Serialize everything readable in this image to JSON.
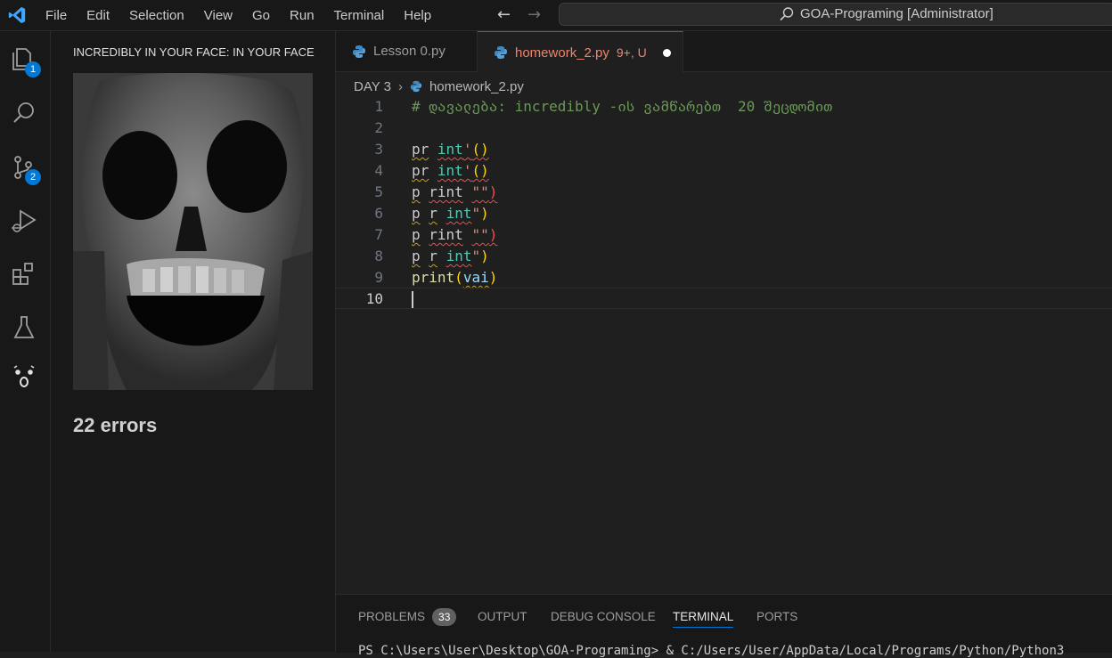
{
  "titlebar": {
    "menu": [
      "File",
      "Edit",
      "Selection",
      "View",
      "Go",
      "Run",
      "Terminal",
      "Help"
    ],
    "search_text": "GOA-Programing [Administrator]"
  },
  "activitybar": {
    "explorer_badge": "1",
    "scm_badge": "2"
  },
  "sidepanel": {
    "heading": "INCREDIBLY IN YOUR FACE: IN YOUR FACE",
    "error_count": "22 errors"
  },
  "tabs": [
    {
      "label": "Lesson 0.py"
    },
    {
      "label": "homework_2.py",
      "status": "9+, U"
    }
  ],
  "breadcrumb": {
    "folder": "DAY 3",
    "file": "homework_2.py"
  },
  "editor": {
    "line_numbers": [
      "1",
      "2",
      "3",
      "4",
      "5",
      "6",
      "7",
      "8",
      "9",
      "10"
    ],
    "comment": "# დავალება: incredibly -ის ვამწარებთ  20 შეცდომით",
    "l3": {
      "a": "pr",
      "b": "int",
      "c": "'",
      "d": "()"
    },
    "l4": {
      "a": "pr",
      "b": "int",
      "c": "'",
      "d": "()"
    },
    "l5": {
      "a": "p",
      "b": "rint",
      "c": "\"\"",
      "d": ")"
    },
    "l6": {
      "a": "p",
      "b": "r",
      "c": "int",
      "d": "\"",
      "e": ")"
    },
    "l7": {
      "a": "p",
      "b": "rint",
      "c": "\"\"",
      "d": ")"
    },
    "l8": {
      "a": "p",
      "b": "r",
      "c": "int",
      "d": "\"",
      "e": ")"
    },
    "l9": {
      "a": "print",
      "b": "(",
      "c": "vai",
      "d": ")"
    }
  },
  "bottompanel": {
    "tabs": [
      "PROBLEMS",
      "OUTPUT",
      "DEBUG CONSOLE",
      "TERMINAL",
      "PORTS"
    ],
    "problems_count": "33",
    "terminal_text": "PS C:\\Users\\User\\Desktop\\GOA-Programing> & C:/Users/User/AppData/Local/Programs/Python/Python3"
  },
  "colors": {
    "accent": "#0078d4",
    "modified_tab": "#f0826e",
    "comment": "#6a9955",
    "builtin": "#4ec9b0",
    "warning_squiggle": "#cca700",
    "error_squiggle": "#f14c4c"
  }
}
